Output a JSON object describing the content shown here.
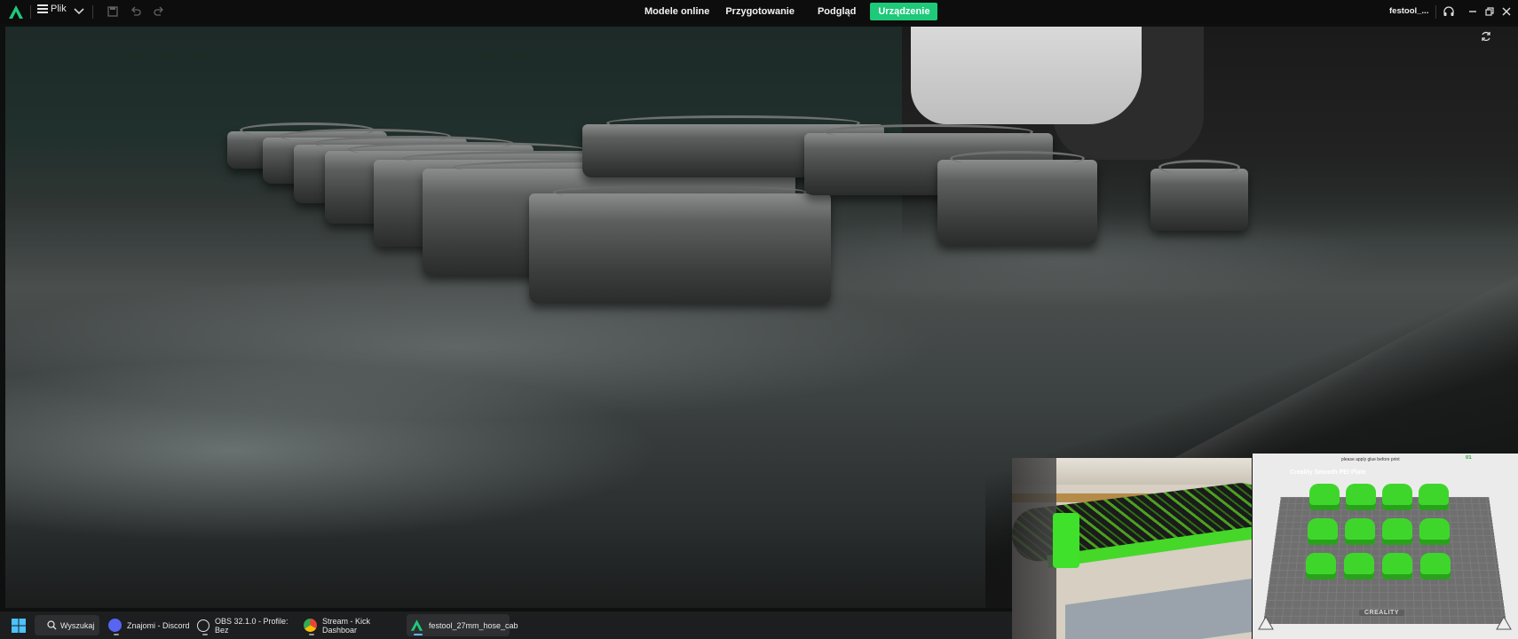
{
  "app": {
    "menu_label": "Plik",
    "tabs": [
      {
        "label": "Modele online",
        "active": false
      },
      {
        "label": "Przygotowanie",
        "active": false
      },
      {
        "label": "Podgląd",
        "active": false
      },
      {
        "label": "Urządzenie",
        "active": true
      }
    ],
    "user_label": "festool_...",
    "accent_color": "#1ec97a"
  },
  "camera": {
    "icons": [
      "refresh-icon"
    ]
  },
  "plate_preview": {
    "header_text": "please apply glue before print",
    "plate_name": "Creality Smooth PEI Plate",
    "plate_number": "01",
    "brand": "CREALITY",
    "part_color": "#3fd62c"
  },
  "taskbar": {
    "search_label": "Wyszukaj",
    "apps": [
      {
        "label": "Znajomi - Discord",
        "color": "#5865f2",
        "active": false
      },
      {
        "label": "OBS 32.1.0 - Profile: Bez",
        "color": "#e0e0e0",
        "active": false
      },
      {
        "label": "Stream - Kick Dashboar",
        "color": "#34a853",
        "active": false
      },
      {
        "label": "festool_27mm_hose_cab",
        "color": "#1ec97a",
        "active": true
      }
    ]
  }
}
